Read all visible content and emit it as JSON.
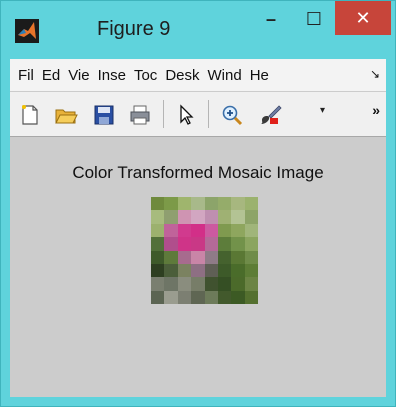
{
  "window": {
    "title": "Figure 9",
    "minimize_glyph": "–",
    "maximize_glyph": "☐",
    "close_glyph": "✕"
  },
  "menu": {
    "items": [
      "Fil",
      "Ed",
      "Vie",
      "Inse",
      "Toc",
      "Desk",
      "Wind",
      "He"
    ],
    "overflow_glyph": "↘"
  },
  "toolbar": {
    "icons": [
      "new-figure-icon",
      "open-file-icon",
      "save-icon",
      "print-icon",
      "pointer-icon",
      "zoom-in-icon",
      "brush-icon"
    ],
    "dropdown_glyph": "▾",
    "more_glyph": "»"
  },
  "figure": {
    "title": "Color Transformed Mosaic Image"
  },
  "colors": {
    "titlebar": "#5fd3dc",
    "close_button": "#c7453a",
    "figure_bg": "#cccccc"
  },
  "mosaic": {
    "rows": 8,
    "cols": 8,
    "pixels": [
      [
        "#6f8a3d",
        "#7c9a48",
        "#9fb56d",
        "#a8b98a",
        "#8ca46a",
        "#95ac6a",
        "#a7b77f",
        "#9bb26e"
      ],
      [
        "#a7bb7d",
        "#8f9f70",
        "#cf94b2",
        "#d2a6c1",
        "#bf8fb0",
        "#9fb173",
        "#b3c394",
        "#8da468"
      ],
      [
        "#9cb16e",
        "#c0639a",
        "#d13a8e",
        "#d22f88",
        "#cc5aa0",
        "#7f9a4f",
        "#8ea65e",
        "#a0b57a"
      ],
      [
        "#52703a",
        "#b04e8c",
        "#cf3488",
        "#c93886",
        "#b46a98",
        "#5d7d3b",
        "#72924a",
        "#8ba55f"
      ],
      [
        "#3e5a2a",
        "#5e7a3b",
        "#a76b8e",
        "#c985a7",
        "#8f7b87",
        "#45622e",
        "#5a7834",
        "#6f8c49"
      ],
      [
        "#2e3f21",
        "#4b5e3a",
        "#7b8260",
        "#8e6f83",
        "#5f5f55",
        "#3d5a29",
        "#4a6c2a",
        "#5d7d36"
      ],
      [
        "#7a7f70",
        "#6e7566",
        "#8a8d7e",
        "#777d68",
        "#40522f",
        "#354f24",
        "#4b6a2a",
        "#6b8444"
      ],
      [
        "#5b6452",
        "#9a9c8f",
        "#7c7f72",
        "#5f6653",
        "#6d7b5a",
        "#42592c",
        "#3c5a24",
        "#54702f"
      ]
    ]
  }
}
